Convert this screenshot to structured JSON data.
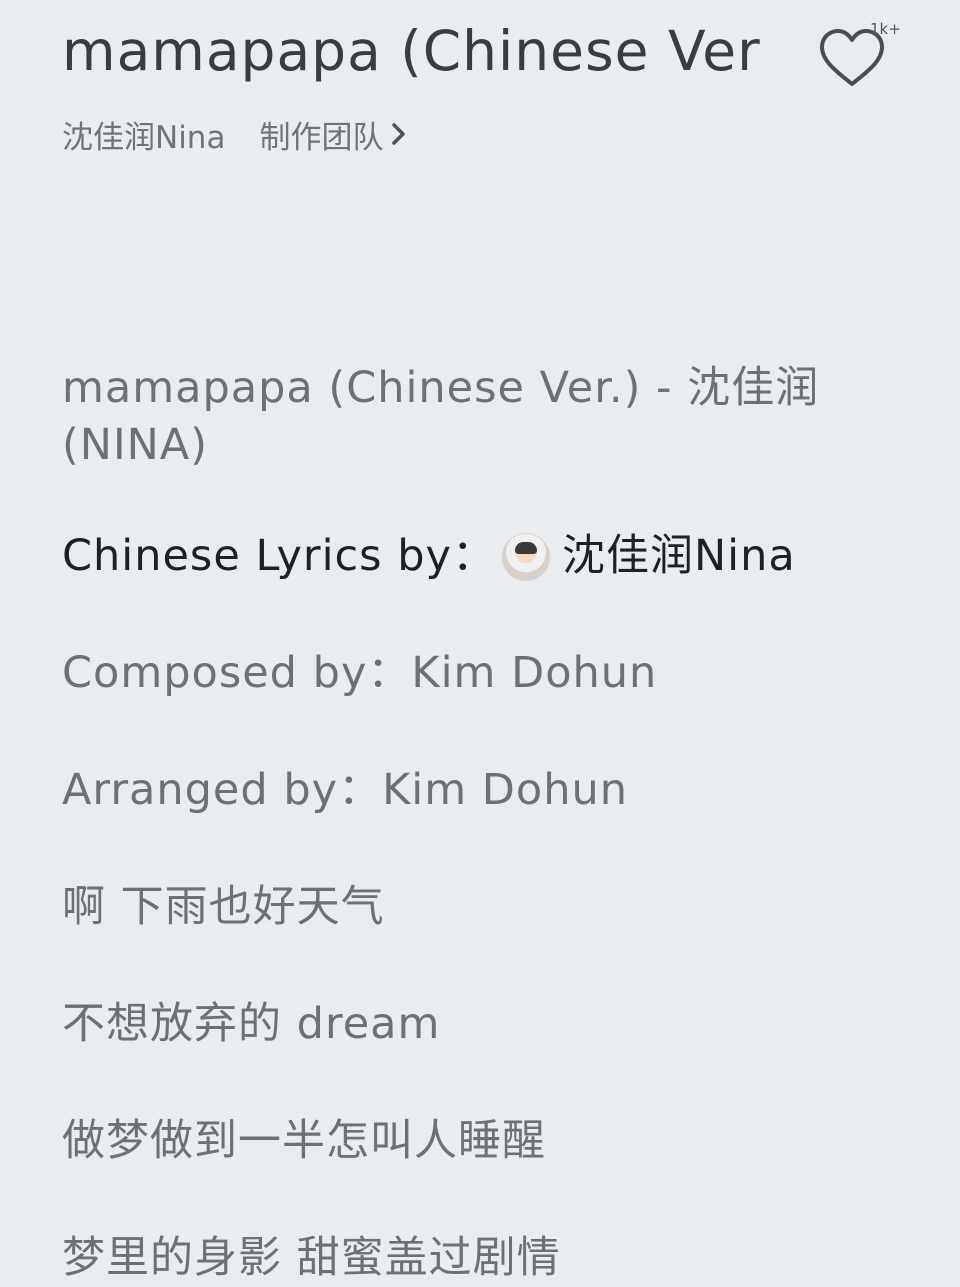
{
  "header": {
    "title": "mamapapa (Chinese Ver.)",
    "like_count": "1k+",
    "artist": "沈佳润Nina",
    "team_link": "制作团队",
    "icons": {
      "like": "heart-outline-icon",
      "team_chevron": "chevron-right-icon"
    }
  },
  "lyrics": {
    "song_header": "mamapapa (Chinese Ver.) - 沈佳润(NINA)",
    "credit_lyrics_label": "Chinese Lyrics by：",
    "credit_lyrics_name": "沈佳润Nina",
    "composed": "Composed by：Kim Dohun",
    "arranged": "Arranged by：Kim Dohun",
    "lines": [
      "啊 下雨也好天气",
      "不想放弃的 dream",
      "做梦做到一半怎叫人睡醒",
      "梦里的身影 甜蜜盖过剧情"
    ]
  },
  "colors": {
    "background": "#e9edf0",
    "title": "#3a3c3e",
    "muted_text": "#6d7175",
    "active_text": "#1e2022"
  }
}
